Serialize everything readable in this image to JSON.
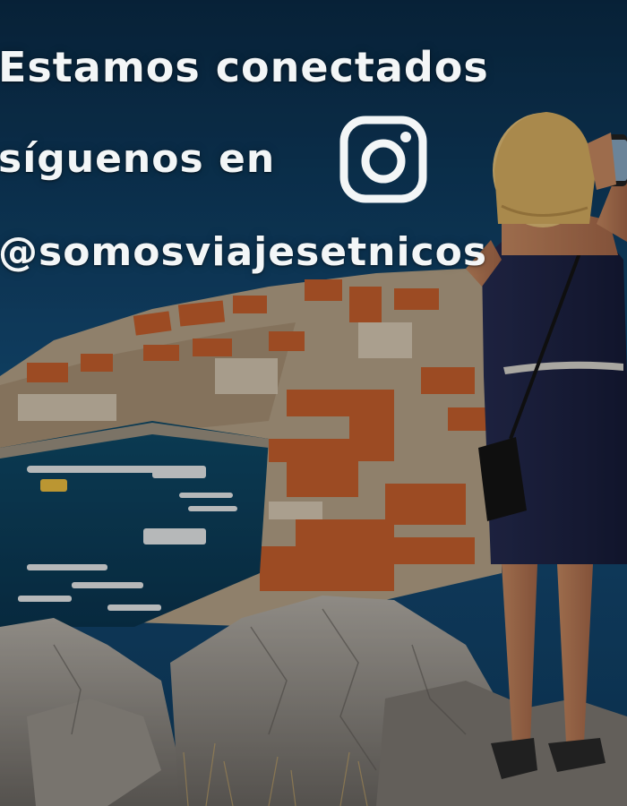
{
  "headline": {
    "line1": "Estamos conectados",
    "line2": "síguenos en",
    "handle": "@somosviajesetnicos"
  },
  "icons": {
    "social": "instagram-icon"
  },
  "colors": {
    "sea": "#0e3f66",
    "deep_sea": "#0a2b47",
    "roof_orange": "#c8602e",
    "rock_gray": "#8f8b86",
    "dress_navy": "#1c2244",
    "text_white": "#f3f6f7"
  }
}
